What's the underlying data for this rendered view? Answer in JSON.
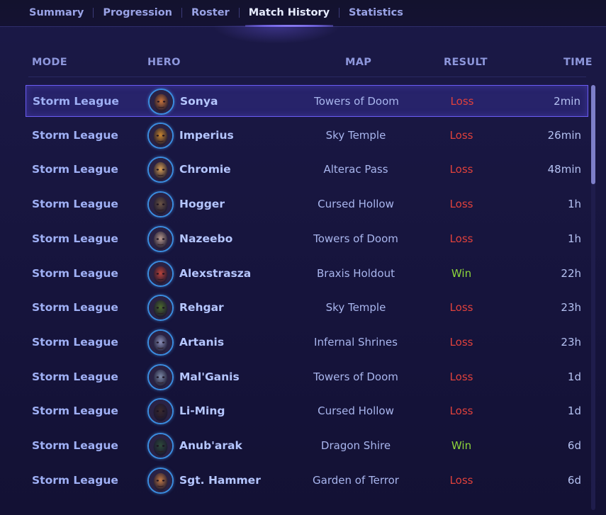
{
  "tabs": [
    {
      "label": "Summary",
      "active": false
    },
    {
      "label": "Progression",
      "active": false
    },
    {
      "label": "Roster",
      "active": false
    },
    {
      "label": "Match History",
      "active": true
    },
    {
      "label": "Statistics",
      "active": false
    }
  ],
  "table": {
    "headers": {
      "mode": "MODE",
      "hero": "HERO",
      "map": "MAP",
      "result": "RESULT",
      "time": "TIME"
    },
    "rows": [
      {
        "mode": "Storm League",
        "hero": "Sonya",
        "map": "Towers of Doom",
        "result": "Loss",
        "time": "2min",
        "portrait_color": "#c8733a",
        "selected": true
      },
      {
        "mode": "Storm League",
        "hero": "Imperius",
        "map": "Sky Temple",
        "result": "Loss",
        "time": "26min",
        "portrait_color": "#c9862f",
        "selected": false
      },
      {
        "mode": "Storm League",
        "hero": "Chromie",
        "map": "Alterac Pass",
        "result": "Loss",
        "time": "48min",
        "portrait_color": "#d9a055",
        "selected": false
      },
      {
        "mode": "Storm League",
        "hero": "Hogger",
        "map": "Cursed Hollow",
        "result": "Loss",
        "time": "1h",
        "portrait_color": "#6b5444",
        "selected": false
      },
      {
        "mode": "Storm League",
        "hero": "Nazeebo",
        "map": "Towers of Doom",
        "result": "Loss",
        "time": "1h",
        "portrait_color": "#b89a8e",
        "selected": false
      },
      {
        "mode": "Storm League",
        "hero": "Alexstrasza",
        "map": "Braxis Holdout",
        "result": "Win",
        "time": "22h",
        "portrait_color": "#b9433a",
        "selected": false
      },
      {
        "mode": "Storm League",
        "hero": "Rehgar",
        "map": "Sky Temple",
        "result": "Loss",
        "time": "23h",
        "portrait_color": "#4d6b2e",
        "selected": false
      },
      {
        "mode": "Storm League",
        "hero": "Artanis",
        "map": "Infernal Shrines",
        "result": "Loss",
        "time": "23h",
        "portrait_color": "#8a8fb8",
        "selected": false
      },
      {
        "mode": "Storm League",
        "hero": "Mal'Ganis",
        "map": "Towers of Doom",
        "result": "Loss",
        "time": "1d",
        "portrait_color": "#7d8aa8",
        "selected": false
      },
      {
        "mode": "Storm League",
        "hero": "Li-Ming",
        "map": "Cursed Hollow",
        "result": "Loss",
        "time": "1d",
        "portrait_color": "#3a2a2e",
        "selected": false
      },
      {
        "mode": "Storm League",
        "hero": "Anub'arak",
        "map": "Dragon Shire",
        "result": "Win",
        "time": "6d",
        "portrait_color": "#2e4a3a",
        "selected": false
      },
      {
        "mode": "Storm League",
        "hero": "Sgt. Hammer",
        "map": "Garden of Terror",
        "result": "Loss",
        "time": "6d",
        "portrait_color": "#c27a45",
        "selected": false
      }
    ]
  },
  "colors": {
    "loss": "#e0413c",
    "win": "#8ed63a",
    "accent": "#6a5cf2"
  }
}
